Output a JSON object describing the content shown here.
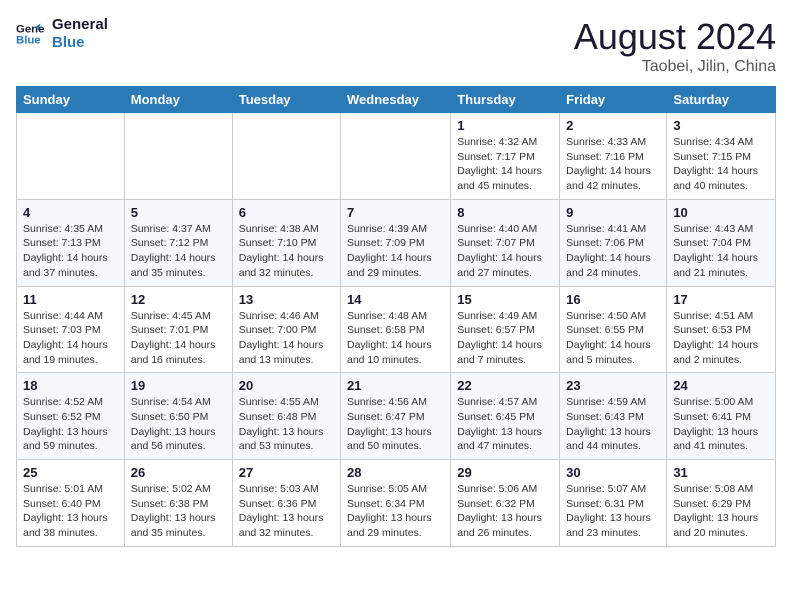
{
  "logo": {
    "line1": "General",
    "line2": "Blue"
  },
  "title": "August 2024",
  "subtitle": "Taobei, Jilin, China",
  "days_of_week": [
    "Sunday",
    "Monday",
    "Tuesday",
    "Wednesday",
    "Thursday",
    "Friday",
    "Saturday"
  ],
  "weeks": [
    [
      {
        "day": "",
        "info": ""
      },
      {
        "day": "",
        "info": ""
      },
      {
        "day": "",
        "info": ""
      },
      {
        "day": "",
        "info": ""
      },
      {
        "day": "1",
        "info": "Sunrise: 4:32 AM\nSunset: 7:17 PM\nDaylight: 14 hours\nand 45 minutes."
      },
      {
        "day": "2",
        "info": "Sunrise: 4:33 AM\nSunset: 7:16 PM\nDaylight: 14 hours\nand 42 minutes."
      },
      {
        "day": "3",
        "info": "Sunrise: 4:34 AM\nSunset: 7:15 PM\nDaylight: 14 hours\nand 40 minutes."
      }
    ],
    [
      {
        "day": "4",
        "info": "Sunrise: 4:35 AM\nSunset: 7:13 PM\nDaylight: 14 hours\nand 37 minutes."
      },
      {
        "day": "5",
        "info": "Sunrise: 4:37 AM\nSunset: 7:12 PM\nDaylight: 14 hours\nand 35 minutes."
      },
      {
        "day": "6",
        "info": "Sunrise: 4:38 AM\nSunset: 7:10 PM\nDaylight: 14 hours\nand 32 minutes."
      },
      {
        "day": "7",
        "info": "Sunrise: 4:39 AM\nSunset: 7:09 PM\nDaylight: 14 hours\nand 29 minutes."
      },
      {
        "day": "8",
        "info": "Sunrise: 4:40 AM\nSunset: 7:07 PM\nDaylight: 14 hours\nand 27 minutes."
      },
      {
        "day": "9",
        "info": "Sunrise: 4:41 AM\nSunset: 7:06 PM\nDaylight: 14 hours\nand 24 minutes."
      },
      {
        "day": "10",
        "info": "Sunrise: 4:43 AM\nSunset: 7:04 PM\nDaylight: 14 hours\nand 21 minutes."
      }
    ],
    [
      {
        "day": "11",
        "info": "Sunrise: 4:44 AM\nSunset: 7:03 PM\nDaylight: 14 hours\nand 19 minutes."
      },
      {
        "day": "12",
        "info": "Sunrise: 4:45 AM\nSunset: 7:01 PM\nDaylight: 14 hours\nand 16 minutes."
      },
      {
        "day": "13",
        "info": "Sunrise: 4:46 AM\nSunset: 7:00 PM\nDaylight: 14 hours\nand 13 minutes."
      },
      {
        "day": "14",
        "info": "Sunrise: 4:48 AM\nSunset: 6:58 PM\nDaylight: 14 hours\nand 10 minutes."
      },
      {
        "day": "15",
        "info": "Sunrise: 4:49 AM\nSunset: 6:57 PM\nDaylight: 14 hours\nand 7 minutes."
      },
      {
        "day": "16",
        "info": "Sunrise: 4:50 AM\nSunset: 6:55 PM\nDaylight: 14 hours\nand 5 minutes."
      },
      {
        "day": "17",
        "info": "Sunrise: 4:51 AM\nSunset: 6:53 PM\nDaylight: 14 hours\nand 2 minutes."
      }
    ],
    [
      {
        "day": "18",
        "info": "Sunrise: 4:52 AM\nSunset: 6:52 PM\nDaylight: 13 hours\nand 59 minutes."
      },
      {
        "day": "19",
        "info": "Sunrise: 4:54 AM\nSunset: 6:50 PM\nDaylight: 13 hours\nand 56 minutes."
      },
      {
        "day": "20",
        "info": "Sunrise: 4:55 AM\nSunset: 6:48 PM\nDaylight: 13 hours\nand 53 minutes."
      },
      {
        "day": "21",
        "info": "Sunrise: 4:56 AM\nSunset: 6:47 PM\nDaylight: 13 hours\nand 50 minutes."
      },
      {
        "day": "22",
        "info": "Sunrise: 4:57 AM\nSunset: 6:45 PM\nDaylight: 13 hours\nand 47 minutes."
      },
      {
        "day": "23",
        "info": "Sunrise: 4:59 AM\nSunset: 6:43 PM\nDaylight: 13 hours\nand 44 minutes."
      },
      {
        "day": "24",
        "info": "Sunrise: 5:00 AM\nSunset: 6:41 PM\nDaylight: 13 hours\nand 41 minutes."
      }
    ],
    [
      {
        "day": "25",
        "info": "Sunrise: 5:01 AM\nSunset: 6:40 PM\nDaylight: 13 hours\nand 38 minutes."
      },
      {
        "day": "26",
        "info": "Sunrise: 5:02 AM\nSunset: 6:38 PM\nDaylight: 13 hours\nand 35 minutes."
      },
      {
        "day": "27",
        "info": "Sunrise: 5:03 AM\nSunset: 6:36 PM\nDaylight: 13 hours\nand 32 minutes."
      },
      {
        "day": "28",
        "info": "Sunrise: 5:05 AM\nSunset: 6:34 PM\nDaylight: 13 hours\nand 29 minutes."
      },
      {
        "day": "29",
        "info": "Sunrise: 5:06 AM\nSunset: 6:32 PM\nDaylight: 13 hours\nand 26 minutes."
      },
      {
        "day": "30",
        "info": "Sunrise: 5:07 AM\nSunset: 6:31 PM\nDaylight: 13 hours\nand 23 minutes."
      },
      {
        "day": "31",
        "info": "Sunrise: 5:08 AM\nSunset: 6:29 PM\nDaylight: 13 hours\nand 20 minutes."
      }
    ]
  ]
}
